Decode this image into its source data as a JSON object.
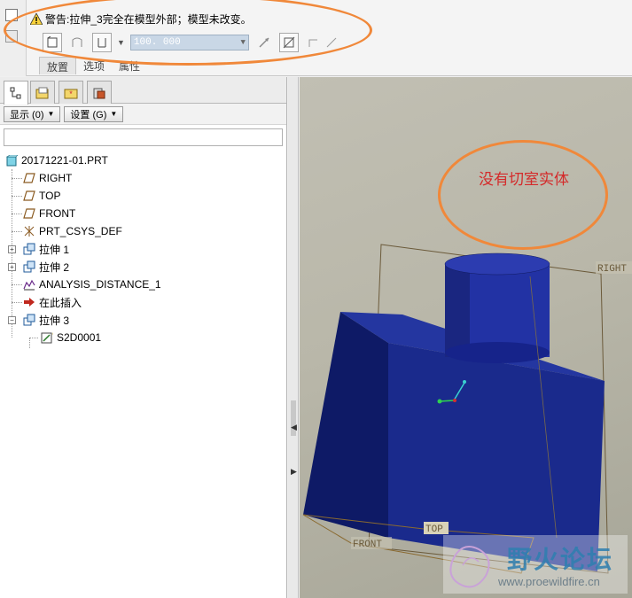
{
  "dashboard": {
    "warning_text": "警告:拉伸_3完全在模型外部；模型未改变。",
    "depth_value": "100. 000",
    "tabs": [
      {
        "label": "放置"
      },
      {
        "label": "选项"
      },
      {
        "label": "属性"
      }
    ]
  },
  "panel": {
    "show_button": "显示 (0)",
    "settings_button": "设置 (G)"
  },
  "tree": {
    "root": "20171221-01.PRT",
    "items": [
      {
        "label": "RIGHT",
        "icon": "datum-plane-icon"
      },
      {
        "label": "TOP",
        "icon": "datum-plane-icon"
      },
      {
        "label": "FRONT",
        "icon": "datum-plane-icon"
      },
      {
        "label": "PRT_CSYS_DEF",
        "icon": "csys-icon"
      },
      {
        "label": "拉伸 1",
        "icon": "extrude-icon"
      },
      {
        "label": "拉伸 2",
        "icon": "extrude-icon"
      },
      {
        "label": "ANALYSIS_DISTANCE_1",
        "icon": "analysis-icon"
      },
      {
        "label": "在此插入",
        "icon": "insert-here-arrow-icon"
      },
      {
        "label": "拉伸 3",
        "icon": "extrude-icon"
      },
      {
        "label": "S2D0001",
        "icon": "sketch-icon"
      }
    ]
  },
  "graphics": {
    "note_text": "没有切室实体",
    "datum_right": "RIGHT",
    "datum_top": "TOP",
    "datum_front": "FRONT"
  },
  "watermark": {
    "title": "野火论坛",
    "url": "www.proewildfire.cn"
  },
  "colors": {
    "model_face_front": "#1a2a8c",
    "model_face_side": "#0e1a66",
    "highlight_orange": "#f0883a",
    "note_red": "#d42a2a",
    "input_blue": "#c9d7e6"
  }
}
